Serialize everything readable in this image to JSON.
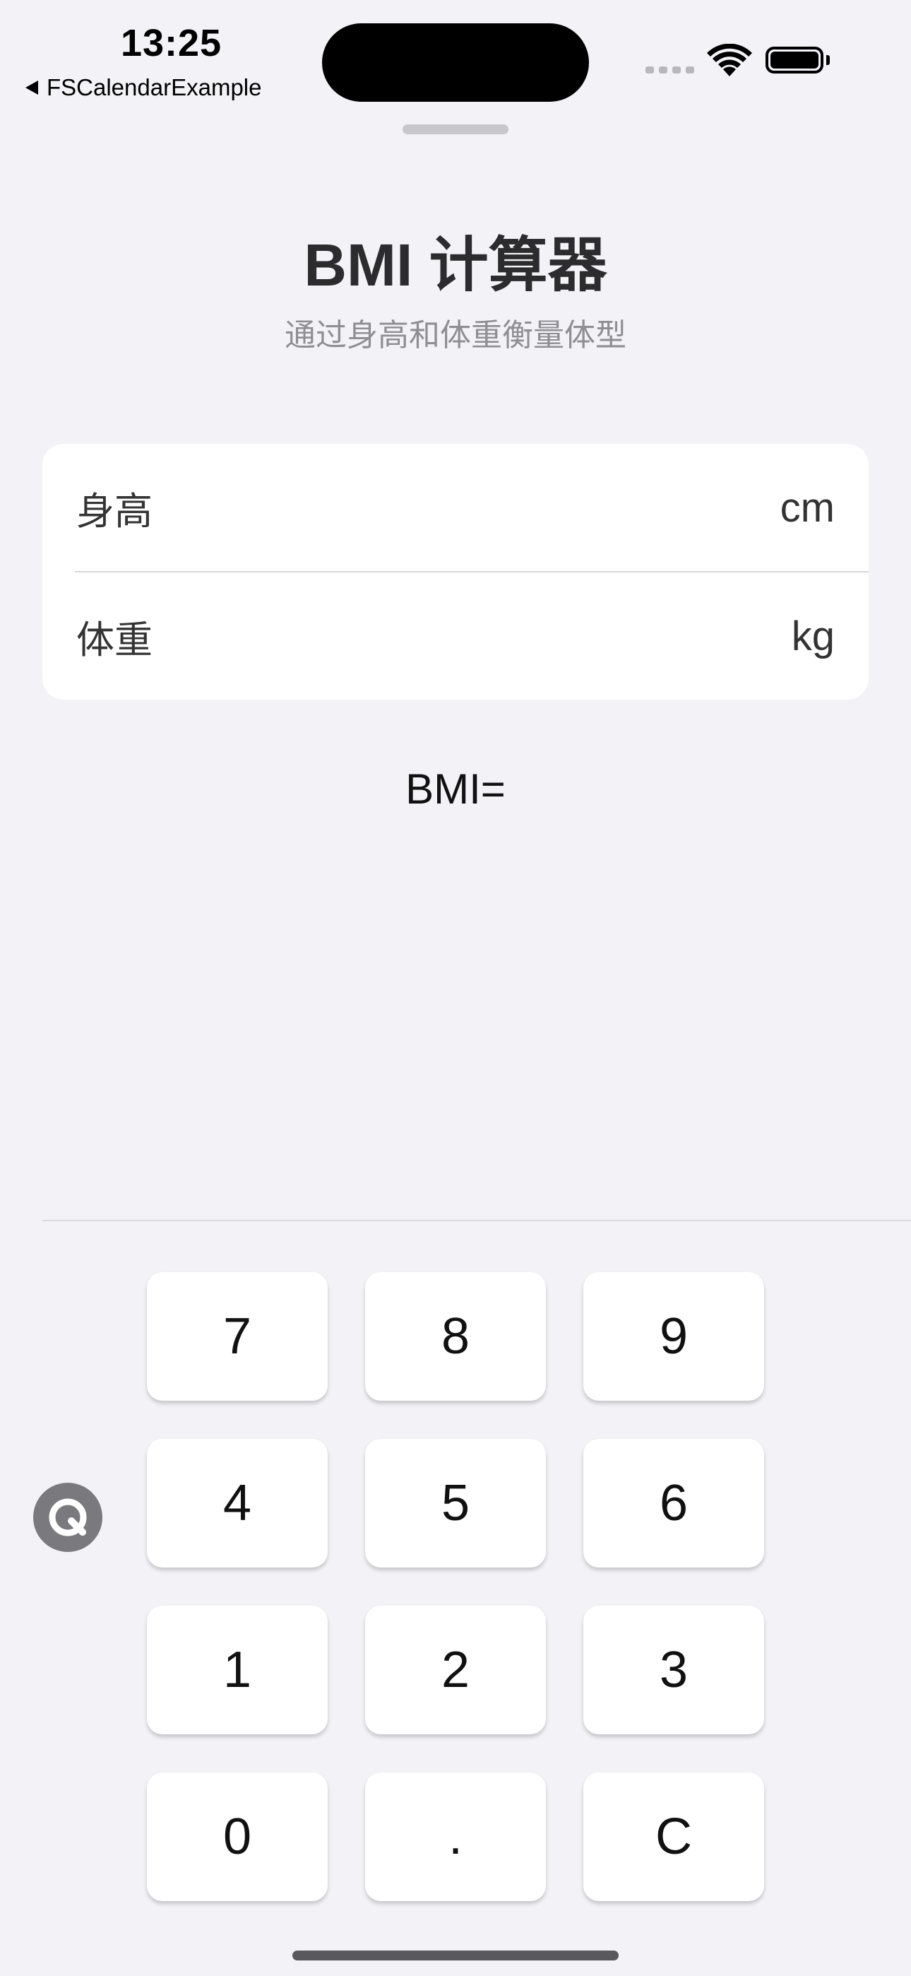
{
  "status_bar": {
    "time": "13:25",
    "back_app": "FSCalendarExample"
  },
  "header": {
    "title": "BMI 计算器",
    "subtitle": "通过身高和体重衡量体型"
  },
  "form": {
    "height": {
      "label": "身高",
      "value": "",
      "unit": "cm"
    },
    "weight": {
      "label": "体重",
      "value": "",
      "unit": "kg"
    }
  },
  "result": {
    "text": "BMI="
  },
  "keypad": {
    "keys": [
      "7",
      "8",
      "9",
      "4",
      "5",
      "6",
      "1",
      "2",
      "3",
      "0",
      ".",
      "C"
    ]
  },
  "colors": {
    "background": "#f2f2f7",
    "card": "#ffffff",
    "title": "#2c2c2e",
    "subtitle": "#8e8e93"
  },
  "icons": {
    "back": "back-triangle-icon",
    "wifi": "wifi-icon",
    "battery": "battery-icon",
    "assistive_touch": "assistive-touch-icon"
  }
}
